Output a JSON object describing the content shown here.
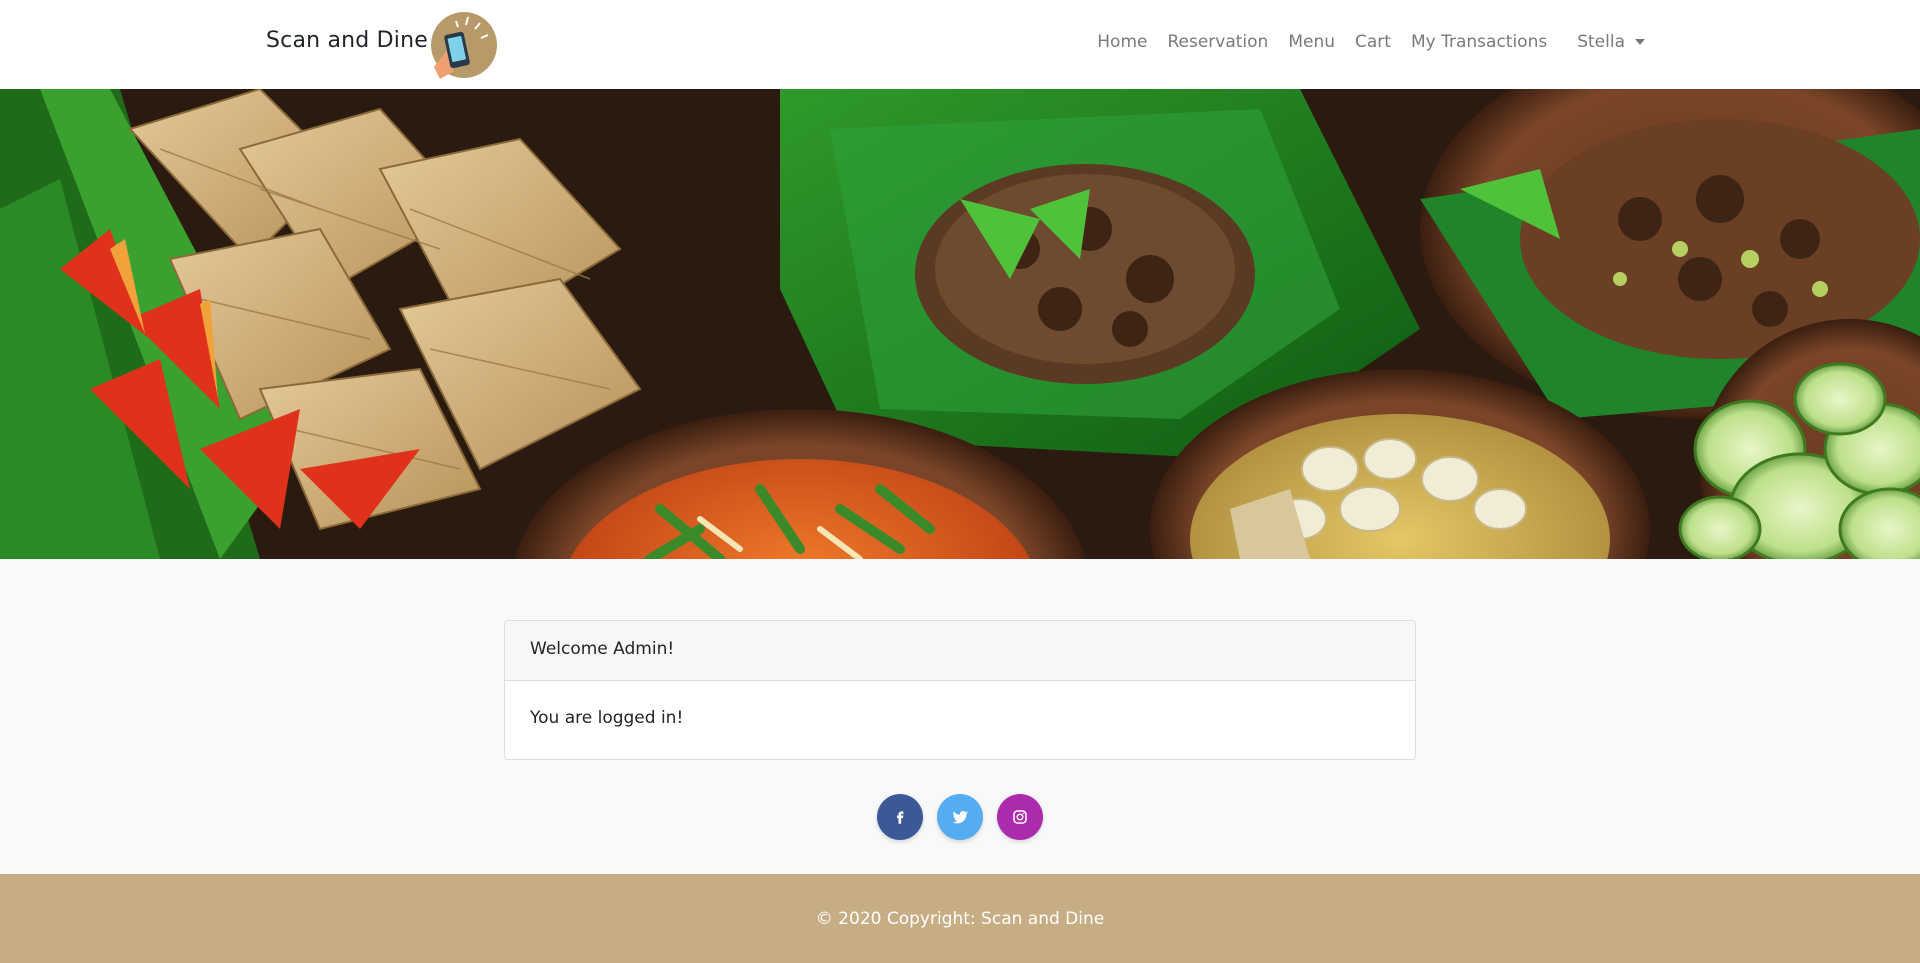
{
  "navbar": {
    "brand": "Scan and Dine",
    "links": [
      "Home",
      "Reservation",
      "Menu",
      "Cart",
      "My Transactions"
    ],
    "user": "Stella"
  },
  "card": {
    "header": "Welcome Admin!",
    "body": "You are logged in!"
  },
  "social": [
    {
      "icon": "facebook-icon",
      "color": "#3b5998"
    },
    {
      "icon": "twitter-icon",
      "color": "#55acee"
    },
    {
      "icon": "instagram-icon",
      "color": "#ac2bac"
    }
  ],
  "footer": {
    "copyright": "© 2020 Copyright: Scan and Dine"
  },
  "colors": {
    "footer_bg": "#c6ad84",
    "page_bg": "#f8f9fb"
  }
}
